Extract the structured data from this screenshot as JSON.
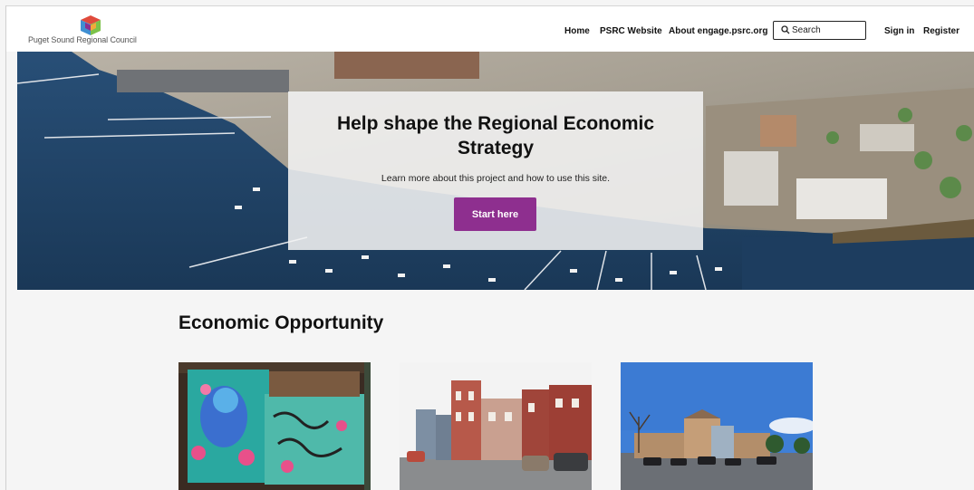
{
  "header": {
    "logo_text": "Puget Sound Regional Council",
    "nav": {
      "home": "Home",
      "psrc_website": "PSRC Website",
      "about": "About engage.psrc.org",
      "sign_in": "Sign in",
      "register": "Register"
    },
    "search": {
      "placeholder": "Search"
    }
  },
  "hero": {
    "title": "Help shape the Regional Economic Strategy",
    "subtitle": "Learn more about this project and how to use this site.",
    "cta_label": "Start here",
    "cta_color": "#8e2f8f"
  },
  "section": {
    "title": "Economic Opportunity"
  },
  "colors": {
    "accent": "#8e2f8f",
    "water": "#1d3f64",
    "page_bg": "#f5f5f5"
  }
}
